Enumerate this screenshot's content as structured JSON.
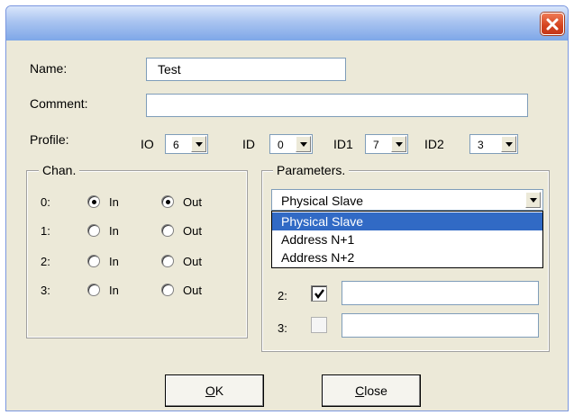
{
  "window": {
    "close_icon": "close-icon"
  },
  "form": {
    "name_label": "Name:",
    "name_value": "Test",
    "comment_label": "Comment:",
    "comment_value": "",
    "profile_label": "Profile:",
    "io_label": "IO",
    "io_value": "6",
    "id_label": "ID",
    "id_value": "0",
    "id1_label": "ID1",
    "id1_value": "7",
    "id2_label": "ID2",
    "id2_value": "3"
  },
  "chan": {
    "title": "Chan.",
    "in_label": "In",
    "out_label": "Out",
    "rows": [
      {
        "num": "0:",
        "in_selected": true,
        "out_selected": true
      },
      {
        "num": "1:",
        "in_selected": false,
        "out_selected": false
      },
      {
        "num": "2:",
        "in_selected": false,
        "out_selected": false
      },
      {
        "num": "3:",
        "in_selected": false,
        "out_selected": false
      }
    ]
  },
  "parameters": {
    "title": "Parameters.",
    "selected": "Physical Slave",
    "options": [
      "Physical Slave",
      "Address N+1",
      "Address N+2"
    ],
    "row2_label": "2:",
    "row2_checked": true,
    "row3_label": "3:",
    "row3_checked": false
  },
  "buttons": {
    "ok_prefix": "O",
    "ok_rest": "K",
    "close_prefix": "C",
    "close_rest": "lose"
  }
}
